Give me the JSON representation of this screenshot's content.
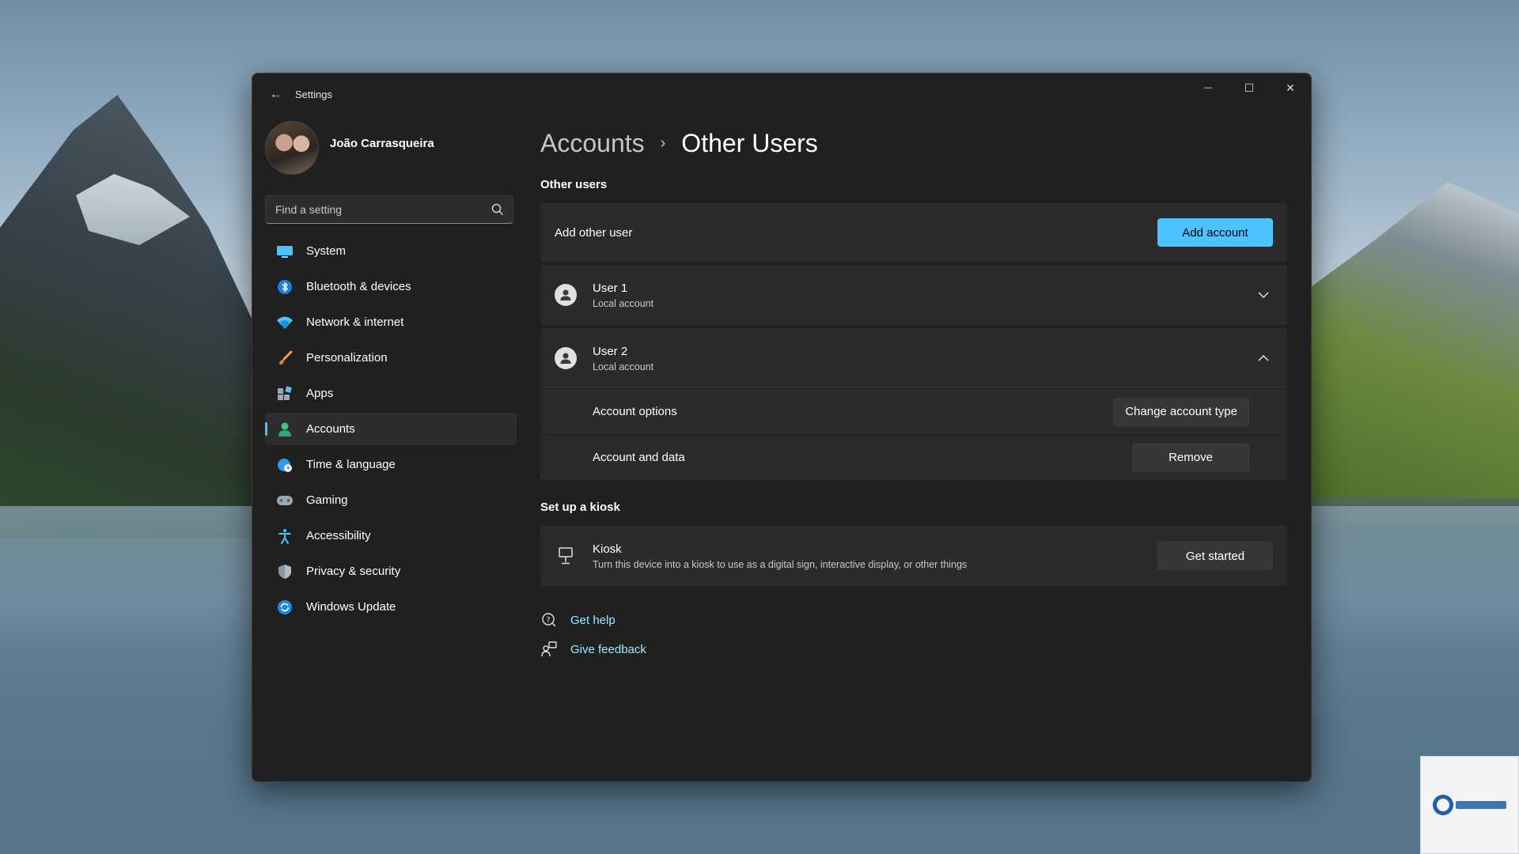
{
  "window": {
    "title": "Settings",
    "minimize_glyph": "—",
    "maximize_glyph": "☐",
    "close_glyph": "✕",
    "back_glyph": "←"
  },
  "profile": {
    "name": "João Carrasqueira"
  },
  "search": {
    "placeholder": "Find a setting",
    "icon": "search-icon"
  },
  "sidebar": {
    "items": [
      {
        "label": "System",
        "icon": "display-icon",
        "active": false
      },
      {
        "label": "Bluetooth & devices",
        "icon": "bluetooth-icon",
        "active": false
      },
      {
        "label": "Network & internet",
        "icon": "wifi-icon",
        "active": false
      },
      {
        "label": "Personalization",
        "icon": "paintbrush-icon",
        "active": false
      },
      {
        "label": "Apps",
        "icon": "apps-icon",
        "active": false
      },
      {
        "label": "Accounts",
        "icon": "accounts-icon",
        "active": true
      },
      {
        "label": "Time & language",
        "icon": "globe-clock-icon",
        "active": false
      },
      {
        "label": "Gaming",
        "icon": "gamepad-icon",
        "active": false
      },
      {
        "label": "Accessibility",
        "icon": "accessibility-icon",
        "active": false
      },
      {
        "label": "Privacy & security",
        "icon": "shield-icon",
        "active": false
      },
      {
        "label": "Windows Update",
        "icon": "update-icon",
        "active": false
      }
    ]
  },
  "breadcrumb": {
    "parent": "Accounts",
    "separator": "›",
    "current": "Other Users"
  },
  "other_users": {
    "section_title": "Other users",
    "add_label": "Add other user",
    "add_button": "Add account",
    "users": [
      {
        "name": "User 1",
        "type": "Local account",
        "expanded": false
      },
      {
        "name": "User 2",
        "type": "Local account",
        "expanded": true,
        "options": [
          {
            "label": "Account options",
            "button": "Change account type"
          },
          {
            "label": "Account and data",
            "button": "Remove"
          }
        ]
      }
    ]
  },
  "kiosk": {
    "section_title": "Set up a kiosk",
    "title": "Kiosk",
    "description": "Turn this device into a kiosk to use as a digital sign, interactive display, or other things",
    "button": "Get started"
  },
  "links": {
    "help": "Get help",
    "feedback": "Give feedback"
  },
  "colors": {
    "accent": "#4cc2ff",
    "link": "#99ebff",
    "window_bg": "#202020",
    "card_bg": "#2b2b2b"
  }
}
